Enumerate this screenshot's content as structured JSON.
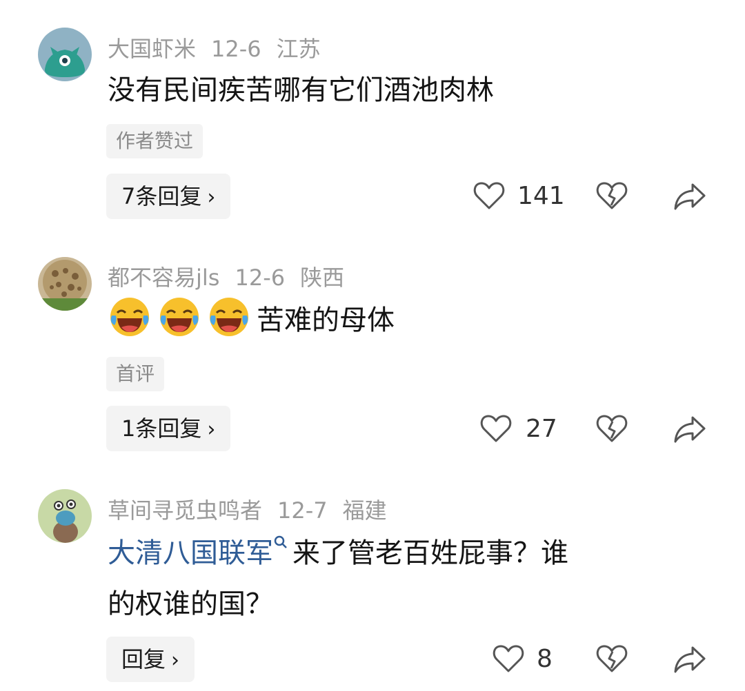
{
  "comments": [
    {
      "username": "大国虾米",
      "date": "12-6",
      "location": "江苏",
      "text": "没有民间疾苦哪有它们酒池肉林",
      "tag": "作者赞过",
      "replies_label": "7条回复",
      "likes": "141"
    },
    {
      "username": "都不容易jls",
      "date": "12-6",
      "location": "陕西",
      "text": "苦难的母体",
      "emoji_count": 3,
      "emoji_name": "laughing-tears-emoji",
      "tag": "首评",
      "replies_label": "1条回复",
      "likes": "27"
    },
    {
      "username": "草间寻觅虫鸣者",
      "date": "12-7",
      "location": "福建",
      "link_text": "大清八国联军",
      "text_line1": "来了管老百姓屁事？谁",
      "text_line2": "的权谁的国？",
      "replies_label": "回复",
      "likes": "8"
    }
  ],
  "icons": {
    "like": "heart-icon",
    "dislike": "broken-heart-icon",
    "share": "share-arrow-icon",
    "chevron": "chevron-right-icon"
  },
  "colors": {
    "meta": "#9a9a9a",
    "tag_bg": "#f3f3f3",
    "link": "#2f5c96"
  }
}
